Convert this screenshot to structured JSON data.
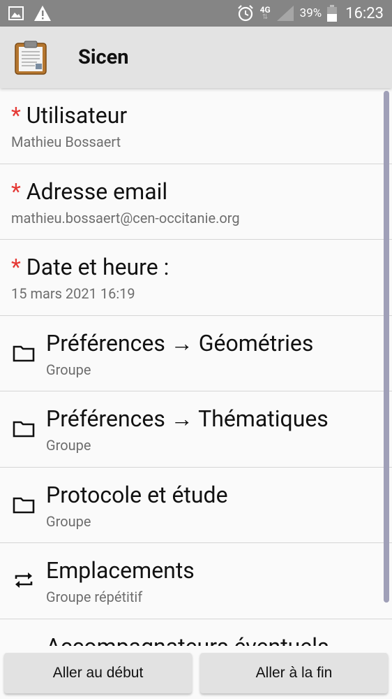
{
  "status_bar": {
    "network": "4G",
    "battery": "39%",
    "time": "16:23"
  },
  "action_bar": {
    "title": "Sicen"
  },
  "rows": [
    {
      "title": "Utilisateur",
      "required": "*",
      "subtitle": "Mathieu Bossaert"
    },
    {
      "title": "Adresse email",
      "required": "*",
      "subtitle": "mathieu.bossaert@cen-occitanie.org"
    },
    {
      "title": "Date et heure :",
      "required": "*",
      "subtitle": "15 mars 2021 16:19"
    },
    {
      "title": "Préférences → Géométries",
      "subtitle": "Groupe",
      "icon": "folder-icon"
    },
    {
      "title": "Préférences → Thématiques",
      "subtitle": "Groupe",
      "icon": "folder-icon"
    },
    {
      "title": "Protocole et étude",
      "subtitle": "Groupe",
      "icon": "folder-icon"
    },
    {
      "title": "Emplacements",
      "subtitle": "Groupe répétitif",
      "icon": "repeat-icon"
    },
    {
      "title": "Accompagnateurs éventuels",
      "subtitle": "",
      "icon": "minus-icon"
    }
  ],
  "buttons": {
    "go_start": "Aller au début",
    "go_end": "Aller à la fin"
  },
  "colors": {
    "status_bar": "#858585",
    "action_bar": "#e3e3e3",
    "required": "#e53935",
    "scrollbar": "#a0a0b8"
  }
}
